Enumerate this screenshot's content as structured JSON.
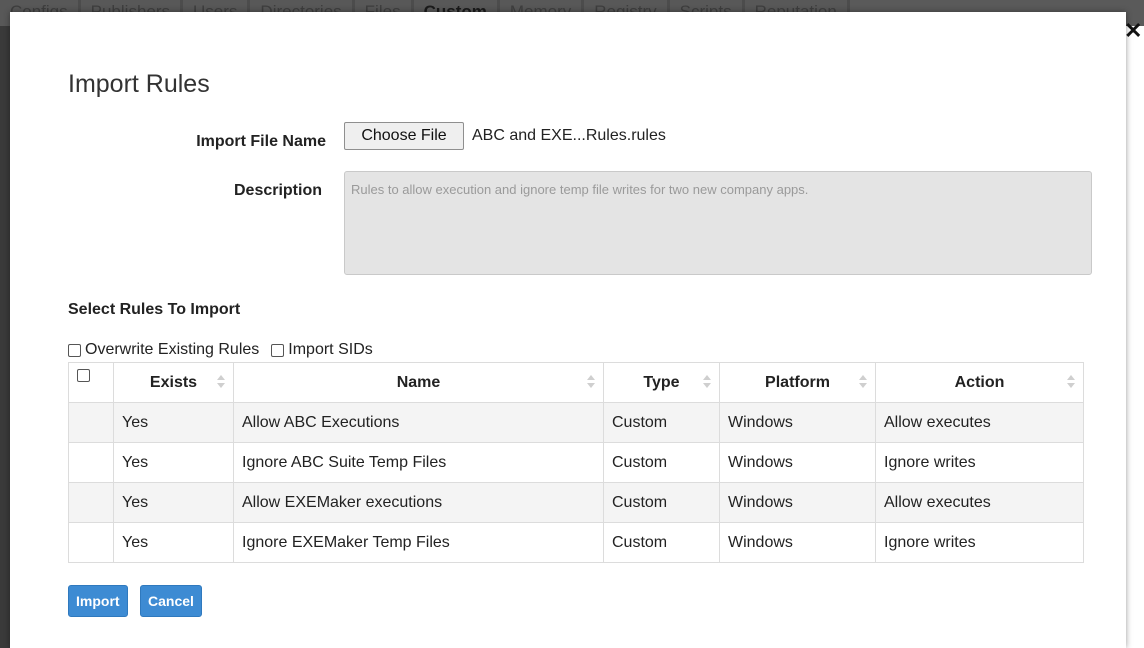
{
  "background": {
    "tabs": [
      "Configs",
      "Publishers",
      "Users",
      "Directories",
      "Files",
      "Custom",
      "Memory",
      "Registry",
      "Scripts",
      "Reputation"
    ],
    "active_tab": "Custom"
  },
  "dialog": {
    "title": "Import Rules",
    "close_icon": "close-icon",
    "close_glyph": "✕",
    "import_file_label": "Import File Name",
    "choose_file_label": "Choose File",
    "file_name": "ABC and EXE...Rules.rules",
    "description_label": "Description",
    "description_value": "Rules to allow execution and ignore temp file writes for two new company apps.",
    "section_title": "Select Rules To Import",
    "options": {
      "overwrite_label": "Overwrite Existing Rules",
      "import_sids_label": "Import SIDs"
    },
    "table": {
      "columns": [
        "Exists",
        "Name",
        "Type",
        "Platform",
        "Action"
      ],
      "rows": [
        [
          "Yes",
          "Allow ABC Executions",
          "Custom",
          "Windows",
          "Allow executes"
        ],
        [
          "Yes",
          "Ignore ABC Suite Temp Files",
          "Custom",
          "Windows",
          "Ignore writes"
        ],
        [
          "Yes",
          "Allow EXEMaker executions",
          "Custom",
          "Windows",
          "Allow executes"
        ],
        [
          "Yes",
          "Ignore EXEMaker Temp Files",
          "Custom",
          "Windows",
          "Ignore writes"
        ]
      ]
    },
    "import_button": "Import",
    "cancel_button": "Cancel"
  },
  "colors": {
    "primary_button": "#3d8bd3",
    "description_bg": "#e4e4e4"
  }
}
